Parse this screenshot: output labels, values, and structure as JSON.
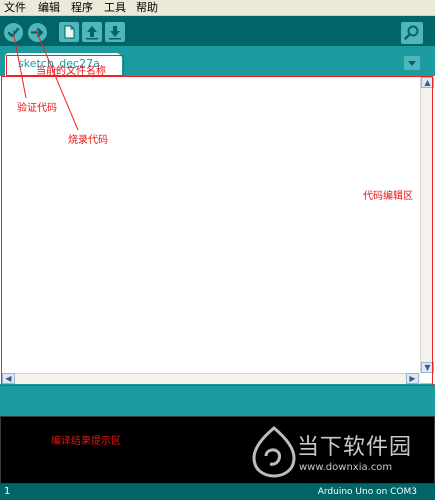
{
  "menubar": {
    "items": [
      {
        "label": "文件"
      },
      {
        "label": "编辑"
      },
      {
        "label": "程序"
      },
      {
        "label": "工具"
      },
      {
        "label": "帮助"
      }
    ]
  },
  "toolbar": {
    "buttons": [
      "verify-check-icon",
      "upload-arrow-icon",
      "new-file-icon",
      "open-file-icon",
      "save-file-icon"
    ],
    "serial_monitor_icon": "magnifier-icon"
  },
  "tabs": {
    "active_label": "sketch_dec27a"
  },
  "status": {
    "line_number": "1",
    "board": "Arduino Uno on COM3"
  },
  "annotations": {
    "file_name": "当前的文件名称",
    "verify": "验证代码",
    "burn": "烧录代码",
    "editor": "代码编辑区",
    "compile": "编译结果提示区"
  },
  "watermark": {
    "brand": "当下软件园",
    "url": "www.downxia.com"
  },
  "colors": {
    "toolbar_dark": "#006468",
    "tab_strip": "#1b9aa0",
    "button_fill": "#4db7bb",
    "annotation_red": "#ee1111"
  }
}
